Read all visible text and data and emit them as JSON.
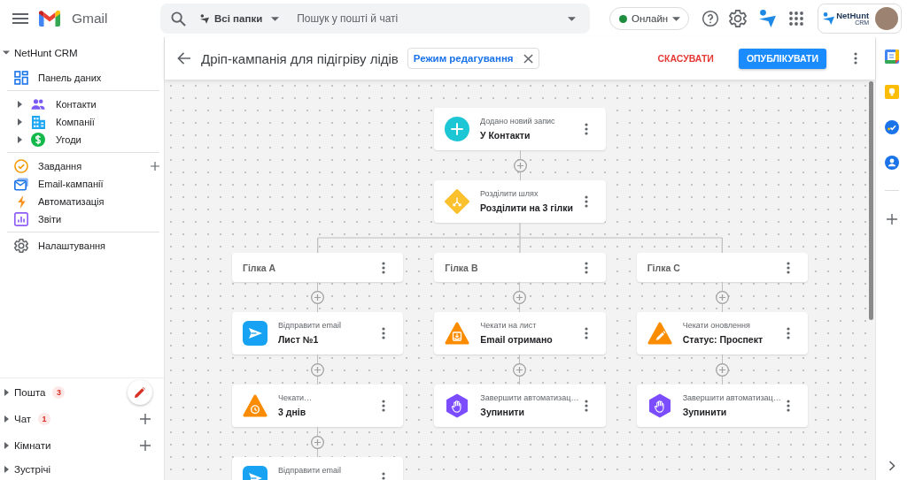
{
  "topbar": {
    "app_name": "Gmail",
    "search": {
      "scope": "Всі папки",
      "placeholder": "Пошук у пошті й чаті"
    },
    "status": {
      "label": "Онлайн",
      "online": true
    },
    "account": {
      "brand": "NetHunt",
      "tagline": "CRM"
    }
  },
  "sidebar": {
    "section": {
      "label": "NetHunt CRM",
      "expanded": true
    },
    "groups": [
      [
        {
          "label": "Панель даних",
          "selected": false,
          "addable": false
        }
      ],
      [
        {
          "label": "Контакти",
          "expanded": false,
          "selected": false,
          "addable": false
        },
        {
          "label": "Компанії",
          "expanded": false,
          "selected": false,
          "addable": false
        },
        {
          "label": "Угоди",
          "expanded": false,
          "selected": false,
          "addable": false
        }
      ],
      [
        {
          "label": "Завдання",
          "selected": false,
          "addable": true
        },
        {
          "label": "Email-кампанії",
          "selected": false,
          "addable": false
        },
        {
          "label": "Автоматизація",
          "selected": false,
          "addable": false
        },
        {
          "label": "Звіти",
          "selected": false,
          "addable": false
        }
      ],
      [
        {
          "label": "Налаштування",
          "selected": false,
          "addable": false
        }
      ]
    ],
    "bottom": [
      {
        "label": "Пошта",
        "badge": "3",
        "expanded": false,
        "compose": true,
        "addable": false
      },
      {
        "label": "Чат",
        "badge": "1",
        "expanded": false,
        "compose": false,
        "addable": true
      },
      {
        "label": "Кімнати",
        "expanded": false,
        "compose": false,
        "addable": true
      },
      {
        "label": "Зустрічі",
        "expanded": false,
        "compose": false,
        "addable": false
      }
    ]
  },
  "editor": {
    "title": "Дріп-кампанія для підігріву лідів",
    "mode": "Режим редагування",
    "cancel": "СКАСУВАТИ",
    "publish": "ОПУБЛІКУВАТИ"
  },
  "flow": {
    "steps": [
      {
        "kind": "trigger",
        "subtitle": "Додано новий запис",
        "title": "У Контакти"
      },
      {
        "kind": "split",
        "subtitle": "Розділити шлях",
        "title": "Розділити на 3 гілки"
      }
    ],
    "branches": [
      {
        "label": "Гілка A",
        "steps": [
          {
            "kind": "send",
            "subtitle": "Відправити email",
            "title": "Лист №1"
          },
          {
            "kind": "delay",
            "subtitle": "Чекати…",
            "title": "3 днів"
          },
          {
            "kind": "send",
            "subtitle": "Відправити email"
          }
        ]
      },
      {
        "label": "Гілка B",
        "steps": [
          {
            "kind": "inbox",
            "subtitle": "Чекати на лист",
            "title": "Email отримано"
          },
          {
            "kind": "stop",
            "subtitle": "Завершити автоматизац…",
            "title": "Зупинити"
          }
        ]
      },
      {
        "label": "Гілка C",
        "steps": [
          {
            "kind": "update",
            "subtitle": "Чекати оновлення",
            "title": "Статус: Проспект"
          },
          {
            "kind": "stop",
            "subtitle": "Завершити автоматизац…",
            "title": "Зупинити"
          }
        ]
      }
    ]
  }
}
